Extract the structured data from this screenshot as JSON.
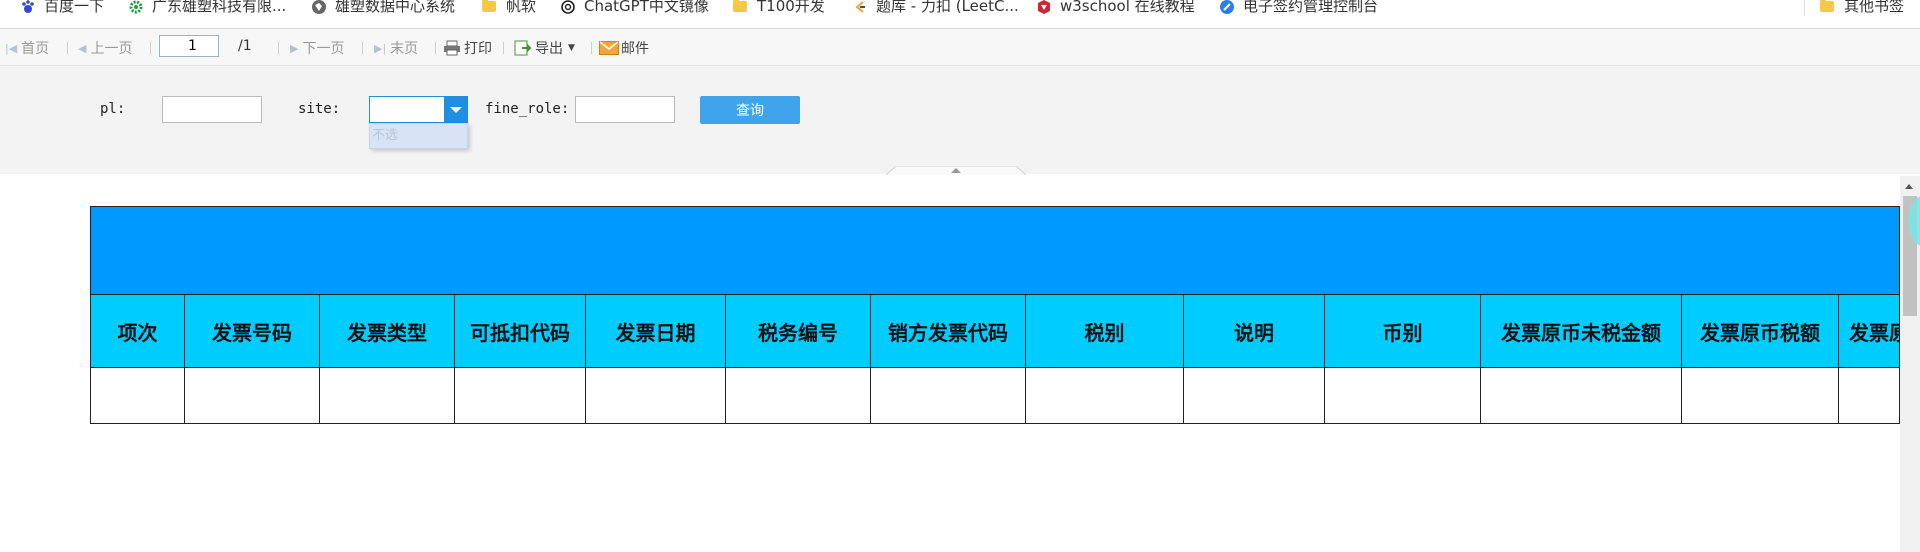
{
  "bookmarks": [
    {
      "label": "百度一下",
      "icon": "baidu-paw-icon"
    },
    {
      "label": "广东雄塑科技有限...",
      "icon": "green-gear-icon"
    },
    {
      "label": "雄塑数据中心系统",
      "icon": "globe-icon"
    },
    {
      "label": "帆软",
      "icon": "folder-icon"
    },
    {
      "label": "ChatGPT中文镜像",
      "icon": "openai-icon"
    },
    {
      "label": "T100开发",
      "icon": "folder-icon"
    },
    {
      "label": "题库 - 力扣 (LeetC...",
      "icon": "leetcode-icon"
    },
    {
      "label": "w3school 在线教程",
      "icon": "w3school-icon"
    },
    {
      "label": "电子签约管理控制台",
      "icon": "blue-circle-icon"
    },
    {
      "label": "其他书签",
      "icon": "folder-icon"
    }
  ],
  "toolbar": {
    "first_page": "首页",
    "prev_page": "上一页",
    "page_value": "1",
    "page_total": "/1",
    "next_page": "下一页",
    "last_page": "末页",
    "print": "打印",
    "export": "导出",
    "mail": "邮件"
  },
  "params": {
    "pl_label": "pl:",
    "site_label": "site:",
    "fine_role_label": "fine_role:",
    "site_option": "不选",
    "query_button": "查询"
  },
  "table": {
    "columns": [
      "项次",
      "发票号码",
      "发票类型",
      "可抵扣代码",
      "发票日期",
      "税务编号",
      "销方发票代码",
      "税别",
      "说明",
      "币别",
      "发票原币未税金额",
      "发票原币税额",
      "发票原"
    ],
    "rows": [
      [
        "",
        "",
        "",
        "",
        "",
        "",
        "",
        "",
        "",
        "",
        "",
        "",
        ""
      ]
    ]
  },
  "colors": {
    "title_band": "#0099ff",
    "header": "#00ccff",
    "query_button": "#3fa4ea"
  }
}
